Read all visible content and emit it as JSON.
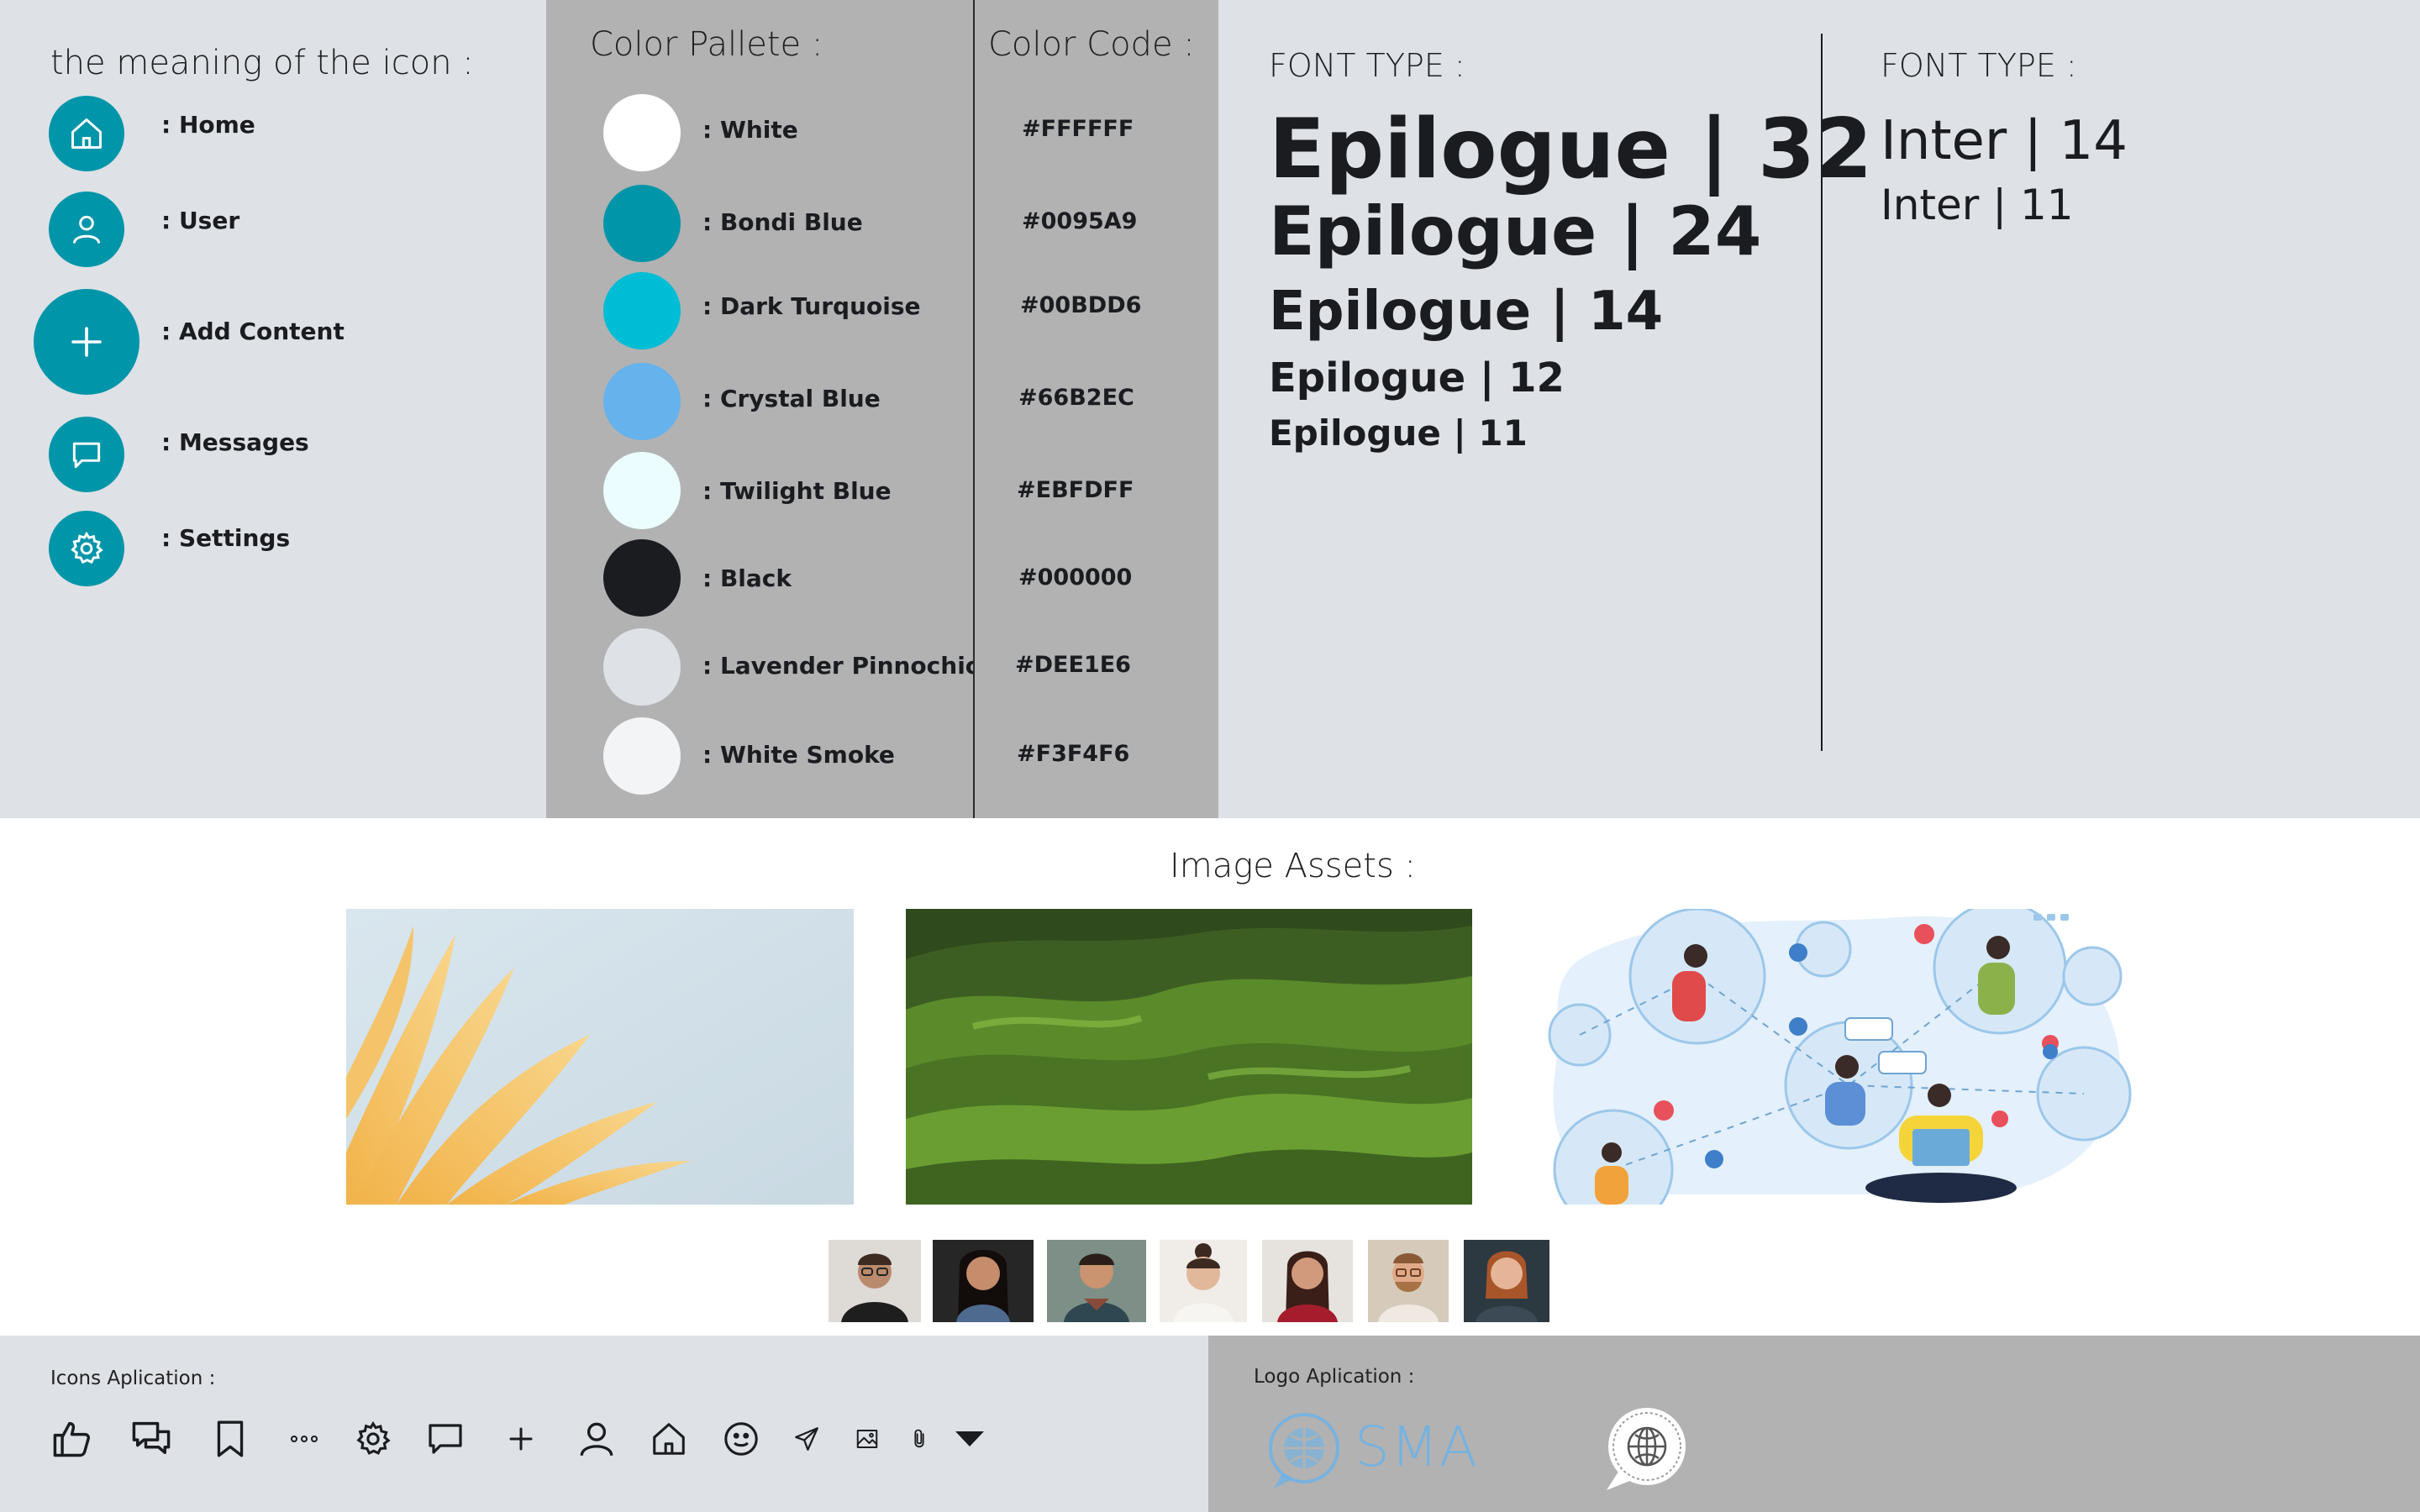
{
  "icon_meaning": {
    "title": "the meaning of the icon :",
    "items": [
      {
        "icon": "home-icon",
        "label": ": Home"
      },
      {
        "icon": "user-icon",
        "label": ": User"
      },
      {
        "icon": "plus-icon",
        "label": ": Add Content"
      },
      {
        "icon": "message-icon",
        "label": ": Messages"
      },
      {
        "icon": "gear-icon",
        "label": ": Settings"
      }
    ]
  },
  "palette": {
    "title": "Color Pallete :",
    "colors": [
      {
        "name": ": White",
        "hex": "#FFFFFF"
      },
      {
        "name": ": Bondi Blue",
        "hex": "#0095A9"
      },
      {
        "name": ": Dark Turquoise",
        "hex": "#00BDD6"
      },
      {
        "name": ": Crystal Blue",
        "hex": "#66B2EC"
      },
      {
        "name": ": Twilight Blue",
        "hex": "#EBFDFF"
      },
      {
        "name": ": Black",
        "hex": "#000000"
      },
      {
        "name": ": Lavender Pinnochio",
        "hex": "#DEE1E6"
      },
      {
        "name": ": White Smoke",
        "hex": "#F3F4F6"
      }
    ]
  },
  "color_code": {
    "title": "Color Code :",
    "codes": [
      "#FFFFFF",
      "#0095A9",
      "#00BDD6",
      "#66B2EC",
      "#EBFDFF",
      "#000000",
      "#DEE1E6",
      "#F3F4F6"
    ]
  },
  "fonts": {
    "epilogue_title": "FONT TYPE :",
    "epilogue_samples": [
      "Epilogue | 32",
      "Epilogue | 24",
      "Epilogue | 14",
      "Epilogue | 12",
      "Epilogue | 11"
    ],
    "inter_title": "FONT TYPE :",
    "inter_samples": [
      "Inter | 14",
      "Inter | 11"
    ]
  },
  "assets": {
    "title": "Image Assets :",
    "images": [
      "yellow-leaves-photo",
      "green-hills-photo",
      "social-network-illustration"
    ],
    "avatars": [
      "avatar-1",
      "avatar-2",
      "avatar-3",
      "avatar-4",
      "avatar-5",
      "avatar-6",
      "avatar-7"
    ]
  },
  "icons_application": {
    "title": "Icons  Aplication :",
    "icons": [
      "thumbs-up-icon",
      "chat-bubbles-icon",
      "bookmark-icon",
      "more-dots-icon",
      "gear-icon",
      "chat-bubble-icon",
      "plus-icon",
      "user-icon",
      "home-icon",
      "smiley-icon",
      "send-icon",
      "image-icon",
      "paperclip-icon",
      "caret-down-icon"
    ]
  },
  "logo_application": {
    "title": "Logo  Aplication :",
    "logo_text": "SMA"
  },
  "colors": {
    "bondi_blue": "#0095A9",
    "lavender": "#DEE1E6",
    "gray_panel": "#B2B2B2",
    "crystal_blue": "#66B2EC"
  }
}
